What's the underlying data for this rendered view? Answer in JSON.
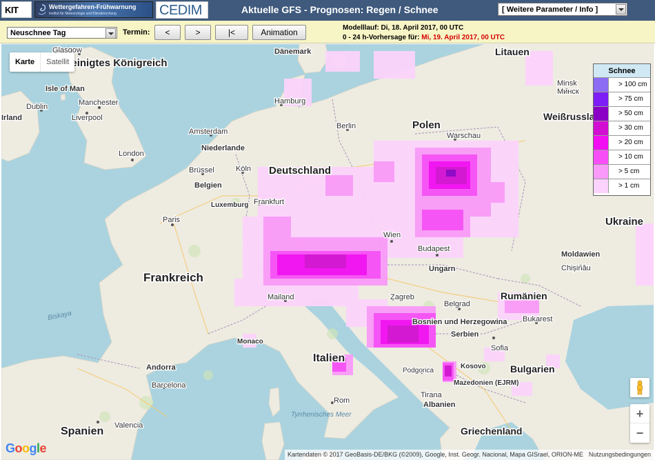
{
  "header": {
    "kit_logo": "KIT",
    "banner_title": "Wettergefahren-Frühwarnung",
    "banner_subtitle": "Institut für Meteorologie und Klimaforschung",
    "cedim_logo": "CEDIM",
    "title": "Aktuelle GFS - Prognosen: Regen / Schnee",
    "param_select": "[ Weitere Parameter / Info ]"
  },
  "toolbar": {
    "type_select": "Neuschnee Tag",
    "termin_label": "Termin:",
    "btn_prev": "<",
    "btn_next": ">",
    "btn_first": "|<",
    "btn_animation": "Animation",
    "model_run": "Modelllauf: Di, 18. April 2017, 00 UTC",
    "forecast_prefix": "0 - 24 h-Vorhersage für: ",
    "forecast_date": "Mi, 19. April 2017, 00 UTC"
  },
  "map_type": {
    "karte": "Karte",
    "satellit": "Satellit"
  },
  "legend": {
    "title": "Schnee",
    "items": [
      {
        "label": "> 100 cm",
        "color": "#8b6cf3"
      },
      {
        "label": "> 75 cm",
        "color": "#7c1ef5"
      },
      {
        "label": "> 50 cm",
        "color": "#8a00c4"
      },
      {
        "label": "> 30 cm",
        "color": "#d20ed2"
      },
      {
        "label": "> 20 cm",
        "color": "#f20cf2"
      },
      {
        "label": "> 10 cm",
        "color": "#f74ef7"
      },
      {
        "label": "> 5 cm",
        "color": "#f99af9"
      },
      {
        "label": "> 1 cm",
        "color": "#fcd3fc"
      }
    ]
  },
  "countries": [
    {
      "id": "uk",
      "label": "Vereinigtes Königreich"
    },
    {
      "id": "de",
      "label": "Deutschland"
    },
    {
      "id": "pl",
      "label": "Polen"
    },
    {
      "id": "lt",
      "label": "Litauen"
    },
    {
      "id": "by",
      "label": "Weißrussland"
    },
    {
      "id": "ua",
      "label": "Ukraine"
    },
    {
      "id": "fr",
      "label": "Frankreich"
    },
    {
      "id": "nl",
      "label": "Niederlande"
    },
    {
      "id": "be",
      "label": "Belgien"
    },
    {
      "id": "lu",
      "label": "Luxemburg"
    },
    {
      "id": "hu",
      "label": "Ungarn"
    },
    {
      "id": "ro",
      "label": "Rumänien"
    },
    {
      "id": "md",
      "label": "Moldawien"
    },
    {
      "id": "it",
      "label": "Italien"
    },
    {
      "id": "es",
      "label": "Spanien"
    },
    {
      "id": "ad",
      "label": "Andorra"
    },
    {
      "id": "bg",
      "label": "Bulgarien"
    },
    {
      "id": "al",
      "label": "Albanien"
    },
    {
      "id": "gr",
      "label": "Griechenland"
    },
    {
      "id": "mk",
      "label": "Mazedonien (EJRM)"
    },
    {
      "id": "ba",
      "label": "Bosnien und Herzegowina"
    },
    {
      "id": "dk",
      "label": "Dänemark"
    },
    {
      "id": "im",
      "label": "Isle of Man"
    },
    {
      "id": "ie",
      "label": "Irland"
    },
    {
      "id": "xk",
      "label": "Kosovo"
    },
    {
      "id": "rs",
      "label": "Serbien"
    },
    {
      "id": "mc",
      "label": "Monaco"
    }
  ],
  "cities": [
    "Glasgow",
    "Dublin",
    "Manchester",
    "Liverpool",
    "London",
    "Amsterdam",
    "Brüssel",
    "Köln",
    "Hamburg",
    "Berlin",
    "Frankfurt",
    "Paris",
    "Warschau",
    "Minsk",
    "Минск",
    "Wien",
    "Budapest",
    "Chișinău",
    "Mailand",
    "Zagreb",
    "Belgrad",
    "Bukarest",
    "Sofia",
    "Podgorica",
    "Tirana",
    "Rom",
    "Barcelona",
    "Valencia"
  ],
  "seas": {
    "biscay": "Biskaya",
    "tyrrhenian": "Tyrrhenisches Meer"
  },
  "attribution": {
    "google": [
      "G",
      "o",
      "o",
      "g",
      "l",
      "e"
    ],
    "text": "Kartendaten © 2017 GeoBasis-DE/BKG (©2009), Google, Inst. Geogr. Nacional, Mapa GISrael, ORION-ME",
    "terms": "Nutzungsbedingungen"
  },
  "controls": {
    "zoom_in": "+",
    "zoom_out": "−"
  }
}
